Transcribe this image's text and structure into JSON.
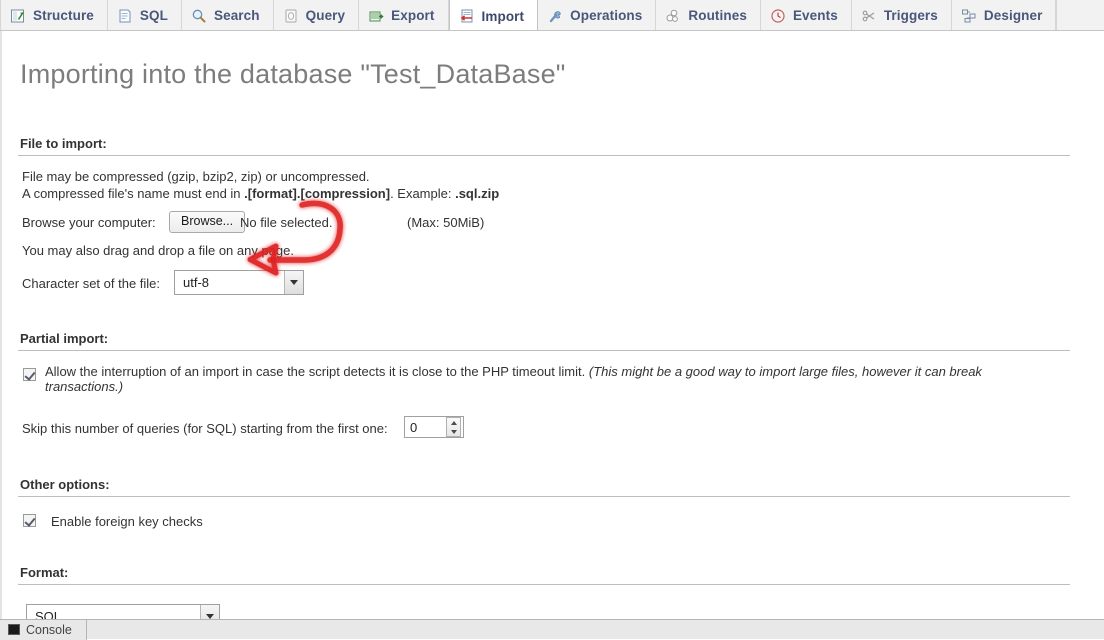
{
  "tabs": [
    {
      "label": "Structure",
      "icon": "structure-icon",
      "active": false
    },
    {
      "label": "SQL",
      "icon": "sql-icon",
      "active": false
    },
    {
      "label": "Search",
      "icon": "search-icon",
      "active": false
    },
    {
      "label": "Query",
      "icon": "query-icon",
      "active": false
    },
    {
      "label": "Export",
      "icon": "export-icon",
      "active": false
    },
    {
      "label": "Import",
      "icon": "import-icon",
      "active": true
    },
    {
      "label": "Operations",
      "icon": "wrench-icon",
      "active": false
    },
    {
      "label": "Routines",
      "icon": "routines-icon",
      "active": false
    },
    {
      "label": "Events",
      "icon": "clock-icon",
      "active": false
    },
    {
      "label": "Triggers",
      "icon": "triggers-icon",
      "active": false
    },
    {
      "label": "Designer",
      "icon": "designer-icon",
      "active": false
    }
  ],
  "page": {
    "title": "Importing into the database \"Test_DataBase\""
  },
  "file_to_import": {
    "legend": "File to import:",
    "line1": "File may be compressed (gzip, bzip2, zip) or uncompressed.",
    "line2_pre": "A compressed file's name must end in ",
    "line2_bold": ".[format].[compression]",
    "line2_mid": ". Example: ",
    "line2_bold2": ".sql.zip",
    "browse_label": "Browse your computer:",
    "browse_button": "Browse...",
    "file_status": "No file selected.",
    "max_size": "(Max: 50MiB)",
    "dragdrop": "You may also drag and drop a file on any page.",
    "charset_label": "Character set of the file:",
    "charset_value": "utf-8"
  },
  "partial_import": {
    "legend": "Partial import:",
    "allow_interrupt_label": "Allow the interruption of an import in case the script detects it is close to the PHP timeout limit.",
    "allow_interrupt_note": "(This might be a good way to import large files, however it can break",
    "allow_interrupt_note2": "transactions.)",
    "allow_interrupt_checked": true,
    "skip_label": "Skip this number of queries (for SQL) starting from the first one:",
    "skip_value": "0"
  },
  "other_options": {
    "legend": "Other options:",
    "fk_label": "Enable foreign key checks",
    "fk_checked": true
  },
  "format": {
    "legend": "Format:",
    "value": "SQL"
  },
  "console": {
    "label": "Console"
  },
  "annotation": {
    "type": "curved-arrow",
    "color": "#e02020",
    "points_to": "browse-button"
  }
}
